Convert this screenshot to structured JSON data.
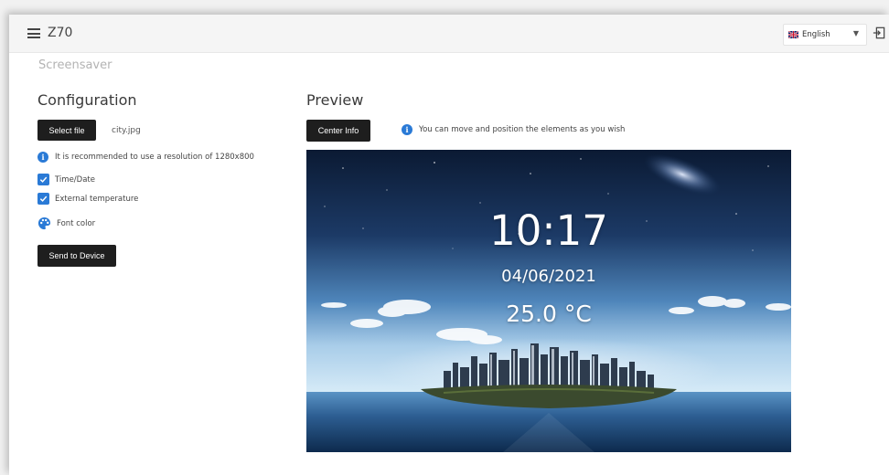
{
  "topbar": {
    "app_title": "Z70",
    "language": "English"
  },
  "page": {
    "section_title": "Screensaver"
  },
  "configuration": {
    "heading": "Configuration",
    "select_file_label": "Select file",
    "file_name": "city.jpg",
    "resolution_hint": "It is recommended to use a resolution of 1280x800",
    "options": [
      {
        "label": "Time/Date",
        "checked": true
      },
      {
        "label": "External temperature",
        "checked": true
      }
    ],
    "font_color_label": "Font color",
    "send_label": "Send to Device"
  },
  "preview": {
    "heading": "Preview",
    "center_label": "Center Info",
    "hint": "You can move and position the elements as you wish",
    "time": "10:17",
    "date": "04/06/2021",
    "temperature": "25.0 °C"
  },
  "colors": {
    "accent": "#2a7ad6",
    "button_bg": "#1e1e1e",
    "overlay_text": "#ffffff"
  },
  "icons": {
    "menu": "hamburger-icon",
    "logout": "logout-icon",
    "info": "info-icon",
    "palette": "palette-icon",
    "flag": "uk-flag-icon",
    "check": "checkmark-icon"
  }
}
